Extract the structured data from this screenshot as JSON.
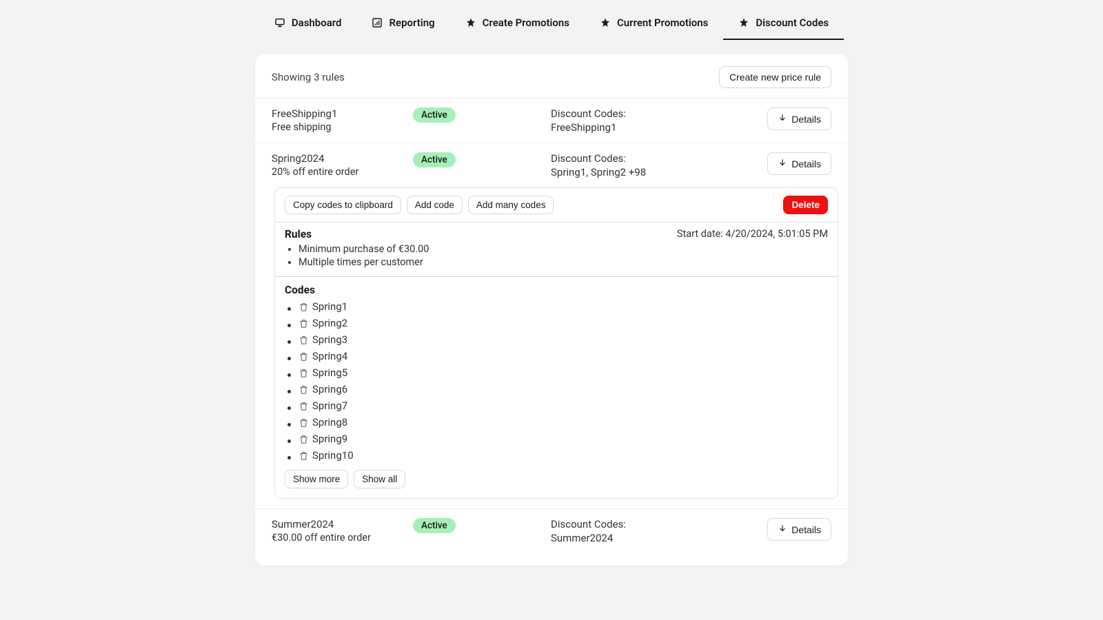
{
  "tabs": [
    {
      "label": "Dashboard",
      "icon": "monitor"
    },
    {
      "label": "Reporting",
      "icon": "chart"
    },
    {
      "label": "Create Promotions",
      "icon": "star"
    },
    {
      "label": "Current Promotions",
      "icon": "star"
    },
    {
      "label": "Discount Codes",
      "icon": "star"
    }
  ],
  "header": {
    "showing": "Showing 3 rules",
    "create_btn": "Create new price rule"
  },
  "details_label": "Details",
  "rules": [
    {
      "name": "FreeShipping1",
      "desc": "Free shipping",
      "status": "Active",
      "codes_label": "Discount Codes:",
      "codes_value": "FreeShipping1"
    },
    {
      "name": "Spring2024",
      "desc": "20% off entire order",
      "status": "Active",
      "codes_label": "Discount Codes:",
      "codes_value": "Spring1, Spring2 +98"
    },
    {
      "name": "Summer2024",
      "desc": "€30.00 off entire order",
      "status": "Active",
      "codes_label": "Discount Codes:",
      "codes_value": "Summer2024"
    }
  ],
  "expanded": {
    "toolbar": {
      "copy": "Copy codes to clipboard",
      "add_code": "Add code",
      "add_many": "Add many codes",
      "delete": "Delete"
    },
    "rules_title": "Rules",
    "start_date": "Start date: 4/20/2024, 5:01:05 PM",
    "rule_items": [
      "Minimum purchase of €30.00",
      "Multiple times per customer"
    ],
    "codes_title": "Codes",
    "codes": [
      "Spring1",
      "Spring2",
      "Spring3",
      "Spring4",
      "Spring5",
      "Spring6",
      "Spring7",
      "Spring8",
      "Spring9",
      "Spring10"
    ],
    "show_more": "Show more",
    "show_all": "Show all"
  }
}
